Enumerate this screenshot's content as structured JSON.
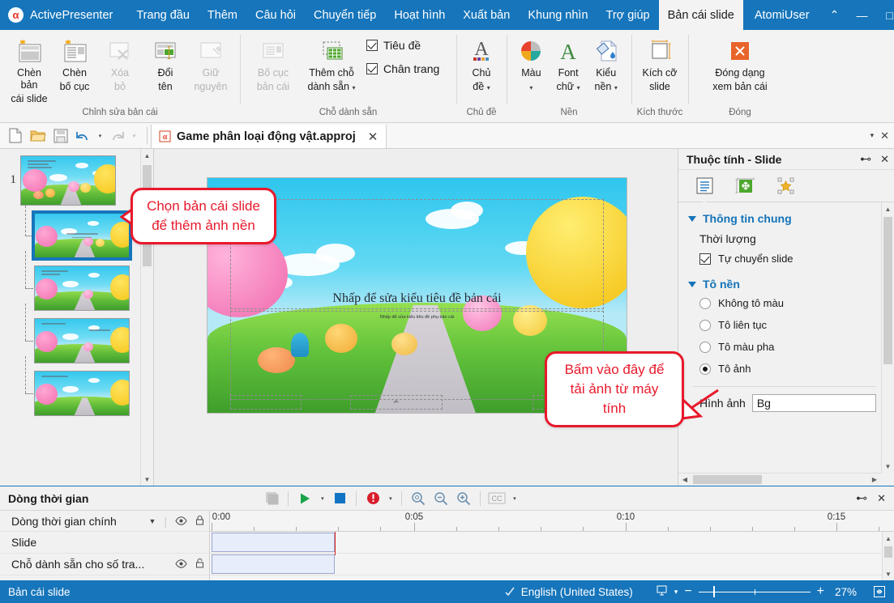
{
  "titlebar": {
    "app_name": "ActivePresenter",
    "logo_glyph": "α",
    "menus": [
      {
        "label": "Trang đầu",
        "active": false
      },
      {
        "label": "Thêm",
        "active": false
      },
      {
        "label": "Câu hỏi",
        "active": false
      },
      {
        "label": "Chuyển tiếp",
        "active": false
      },
      {
        "label": "Hoạt hình",
        "active": false
      },
      {
        "label": "Xuất bản",
        "active": false
      },
      {
        "label": "Khung nhìn",
        "active": false
      },
      {
        "label": "Trợ giúp",
        "active": false
      },
      {
        "label": "Bản cái slide",
        "active": true
      }
    ],
    "user": "AtomiUser",
    "collapse_glyph": "⌃",
    "minimize_glyph": "—",
    "maximize_glyph": "□",
    "close_glyph": "✕"
  },
  "ribbon": {
    "groups": [
      {
        "label": "Chỉnh sửa bản cái",
        "buttons": [
          {
            "label": "Chèn bản\ncái slide",
            "line1": "Chèn bản",
            "line2": "cái slide",
            "disabled": false
          },
          {
            "label": "Chèn bố cục",
            "line1": "Chèn",
            "line2": "bố cục",
            "disabled": false
          },
          {
            "label": "Xóa bỏ",
            "line1": "Xóa",
            "line2": "bỏ",
            "disabled": true
          },
          {
            "label": "Đổi tên",
            "line1": "Đổi",
            "line2": "tên",
            "disabled": false
          },
          {
            "label": "Giữ nguyên",
            "line1": "Giữ",
            "line2": "nguyên",
            "disabled": true
          }
        ]
      },
      {
        "label": "Chỗ dành sẵn",
        "buttons": [
          {
            "line1": "Bố cục",
            "line2": "bản cái",
            "disabled": true
          },
          {
            "line1": "Thêm chỗ",
            "line2": "dành sẵn",
            "disabled": false,
            "has_caret": true
          }
        ],
        "checks": [
          {
            "label": "Tiêu đề",
            "checked": true
          },
          {
            "label": "Chân trang",
            "checked": true
          }
        ]
      },
      {
        "label": "Chủ đề",
        "buttons": [
          {
            "line1": "Chủ",
            "line2": "đề",
            "disabled": false,
            "has_caret": true
          }
        ]
      },
      {
        "label": "Nền",
        "buttons": [
          {
            "line1": "Màu",
            "line2": "",
            "disabled": false,
            "has_caret": true
          },
          {
            "line1": "Font",
            "line2": "chữ",
            "disabled": false,
            "has_caret": true
          },
          {
            "line1": "Kiểu",
            "line2": "nền",
            "disabled": false,
            "has_caret": true
          }
        ]
      },
      {
        "label": "Kích thước",
        "buttons": [
          {
            "line1": "Kích cỡ",
            "line2": "slide",
            "disabled": false
          }
        ]
      },
      {
        "label": "Đóng",
        "buttons": [
          {
            "line1": "Đóng dạng",
            "line2": "xem bản cái",
            "disabled": false
          }
        ]
      }
    ]
  },
  "filebar": {
    "quick_buttons": [
      "new-icon",
      "open-icon",
      "save-icon",
      "undo-icon",
      "redo-icon"
    ],
    "document_tab": {
      "title": "Game phân loại động vật.approj",
      "close_glyph": "✕"
    },
    "right_caret": "▾",
    "right_close": "✕"
  },
  "thumbnails": {
    "slide_number": "1",
    "items": [
      {
        "type": "master",
        "selected": false
      },
      {
        "type": "layout",
        "selected": true
      },
      {
        "type": "layout",
        "selected": false
      },
      {
        "type": "layout",
        "selected": false
      },
      {
        "type": "layout",
        "selected": false
      }
    ]
  },
  "canvas": {
    "title_placeholder": "Nhấp để sửa kiểu tiêu đề bản cái",
    "subtitle_placeholder": "Nhấp để sửa kiểu tiêu đề phụ bản cái",
    "footer_center": "‹#›"
  },
  "callouts": [
    {
      "id": "callout-left",
      "text": "Chọn bản cái slide để thêm ảnh nền",
      "color": "#e8192c"
    },
    {
      "id": "callout-right",
      "text": "Bấm vào đây để tải ảnh từ máy tính",
      "color": "#e8192c"
    }
  ],
  "properties": {
    "title": "Thuộc tính - Slide",
    "pin_glyph": "⊷",
    "close_glyph": "✕",
    "tabs": [
      {
        "name": "slide-properties-tab",
        "active": true
      },
      {
        "name": "size-position-tab",
        "active": false
      },
      {
        "name": "effects-tab",
        "active": false
      }
    ],
    "sections": [
      {
        "title": "Thông tin chung",
        "expanded": true,
        "rows": [
          {
            "type": "label",
            "label": "Thời lượng"
          },
          {
            "type": "checkbox",
            "label": "Tự chuyển slide",
            "checked": true
          }
        ]
      },
      {
        "title": "Tô nền",
        "expanded": true,
        "radios": [
          {
            "label": "Không tô màu",
            "selected": false
          },
          {
            "label": "Tô liên tục",
            "selected": false
          },
          {
            "label": "Tô màu pha",
            "selected": false
          },
          {
            "label": "Tô ảnh",
            "selected": true
          }
        ],
        "field": {
          "label": "Hình ảnh",
          "value": "Bg"
        }
      }
    ]
  },
  "timeline": {
    "title": "Dòng thời gian",
    "tools": [
      {
        "name": "stop-recording-button",
        "glyph": "■"
      },
      {
        "name": "play-button",
        "glyph": "▶"
      },
      {
        "name": "play-dropdown",
        "glyph": "▾"
      },
      {
        "name": "stop-button",
        "glyph": "■"
      },
      {
        "name": "alert-button",
        "glyph": "!"
      },
      {
        "name": "alert-dropdown",
        "glyph": "▾"
      },
      {
        "name": "zoom-fit-button",
        "glyph": "⊙"
      },
      {
        "name": "zoom-out-button",
        "glyph": "−"
      },
      {
        "name": "zoom-in-button",
        "glyph": "+"
      },
      {
        "name": "closed-caption-button",
        "glyph": "CC"
      },
      {
        "name": "cc-dropdown",
        "glyph": "▾"
      }
    ],
    "pin_glyph": "⊷",
    "close_glyph": "✕",
    "main_track_label": "Dòng thời gian chính",
    "rows": [
      {
        "label": "Slide",
        "has_icons": false,
        "clip_end_pct": 4.6
      },
      {
        "label": "Chỗ dành sẵn cho số tra...",
        "has_icons": true,
        "clip_end_pct": 4.6
      }
    ],
    "ruler_labels": [
      "0:00",
      "0:05",
      "0:10",
      "0:15"
    ],
    "ruler_positions": [
      0,
      5,
      10,
      15
    ],
    "ruler_max_seconds": 18.2
  },
  "statusbar": {
    "mode": "Bản cái slide",
    "language": "English (United States)",
    "language_icon": "spell-check-icon",
    "display_icon": "display-mode-icon",
    "display_caret": "▾",
    "zoom_minus": "−",
    "zoom_plus": "+",
    "zoom_percent": "27%",
    "fit_glyph": "⤢"
  }
}
